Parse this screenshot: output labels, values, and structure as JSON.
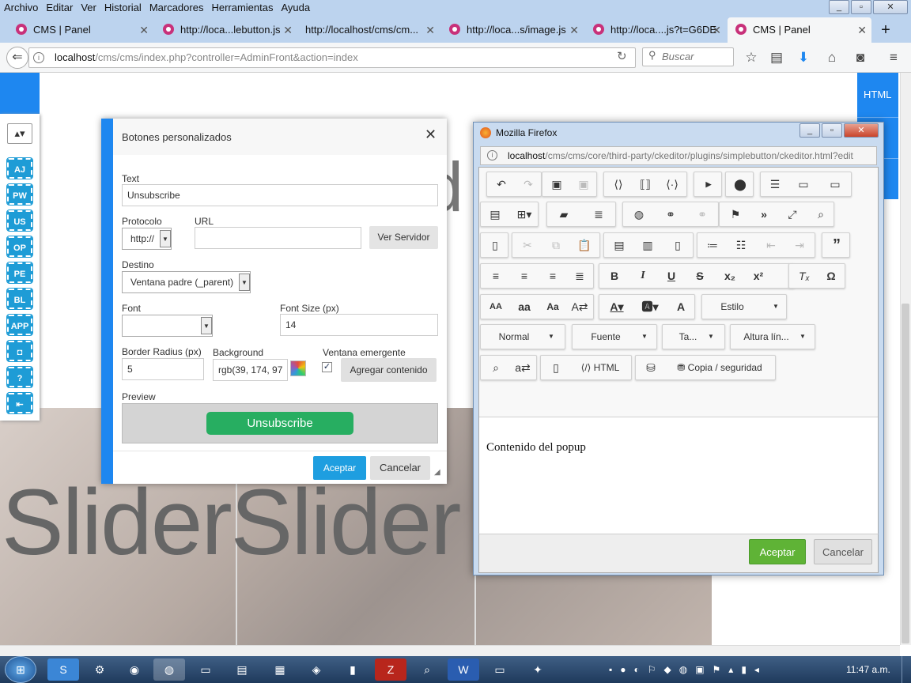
{
  "menubar": {
    "items": [
      "Archivo",
      "Editar",
      "Ver",
      "Historial",
      "Marcadores",
      "Herramientas",
      "Ayuda"
    ]
  },
  "tabs": [
    {
      "label": "CMS | Panel"
    },
    {
      "label": "http://loca...lebutton.js"
    },
    {
      "label": "http://localhost/cms/cm..."
    },
    {
      "label": "http://loca...s/image.js"
    },
    {
      "label": "http://loca....js?t=G6DE"
    },
    {
      "label": "CMS | Panel"
    }
  ],
  "urlbar": {
    "host": "localhost",
    "path": "/cms/cms/index.php?controller=AdminFront&action=index"
  },
  "search": {
    "placeholder": "Buscar"
  },
  "page": {
    "slider_text": "SliderSlider",
    "right_tab": "HTML",
    "tools": [
      "AJ",
      "PW",
      "US",
      "OP",
      "PE",
      "BL",
      "APP",
      "",
      "?",
      ""
    ]
  },
  "dialog": {
    "title": "Botones personalizados",
    "text_label": "Text",
    "text_value": "Unsubscribe",
    "protocol_label": "Protocolo",
    "protocol_value": "http://",
    "url_label": "URL",
    "url_value": "",
    "browse_button": "Ver Servidor",
    "target_label": "Destino",
    "target_value": "Ventana padre (_parent)",
    "font_label": "Font",
    "font_value": "",
    "font_size_label": "Font Size (px)",
    "font_size_value": "14",
    "radius_label": "Border Radius (px)",
    "radius_value": "5",
    "background_label": "Background",
    "background_value": "rgb(39, 174, 97",
    "popup_label": "Ventana emergente",
    "add_content_button": "Agregar contenido",
    "preview_label": "Preview",
    "preview_button": "Unsubscribe",
    "accept": "Aceptar",
    "cancel": "Cancelar",
    "colors": {
      "accent": "#1e87f0",
      "preview_green": "#27ae61",
      "accept": "#1e9ee0"
    }
  },
  "popup": {
    "title": "Mozilla Firefox",
    "url_host": "localhost",
    "url_path": "/cms/cms/core/third-party/ckeditor/plugins/simplebutton/ckeditor.html?edit",
    "styles_combo": "Estilo",
    "format_combo": "Normal",
    "font_combo": "Fuente",
    "size_combo": "Ta...",
    "lineheight_combo": "Altura lín...",
    "html_button": "HTML",
    "copy_button": "Copia / seguridad",
    "content": "Contenido del popup",
    "accept": "Aceptar",
    "cancel": "Cancelar"
  },
  "taskbar": {
    "time": "11:47 a.m."
  }
}
